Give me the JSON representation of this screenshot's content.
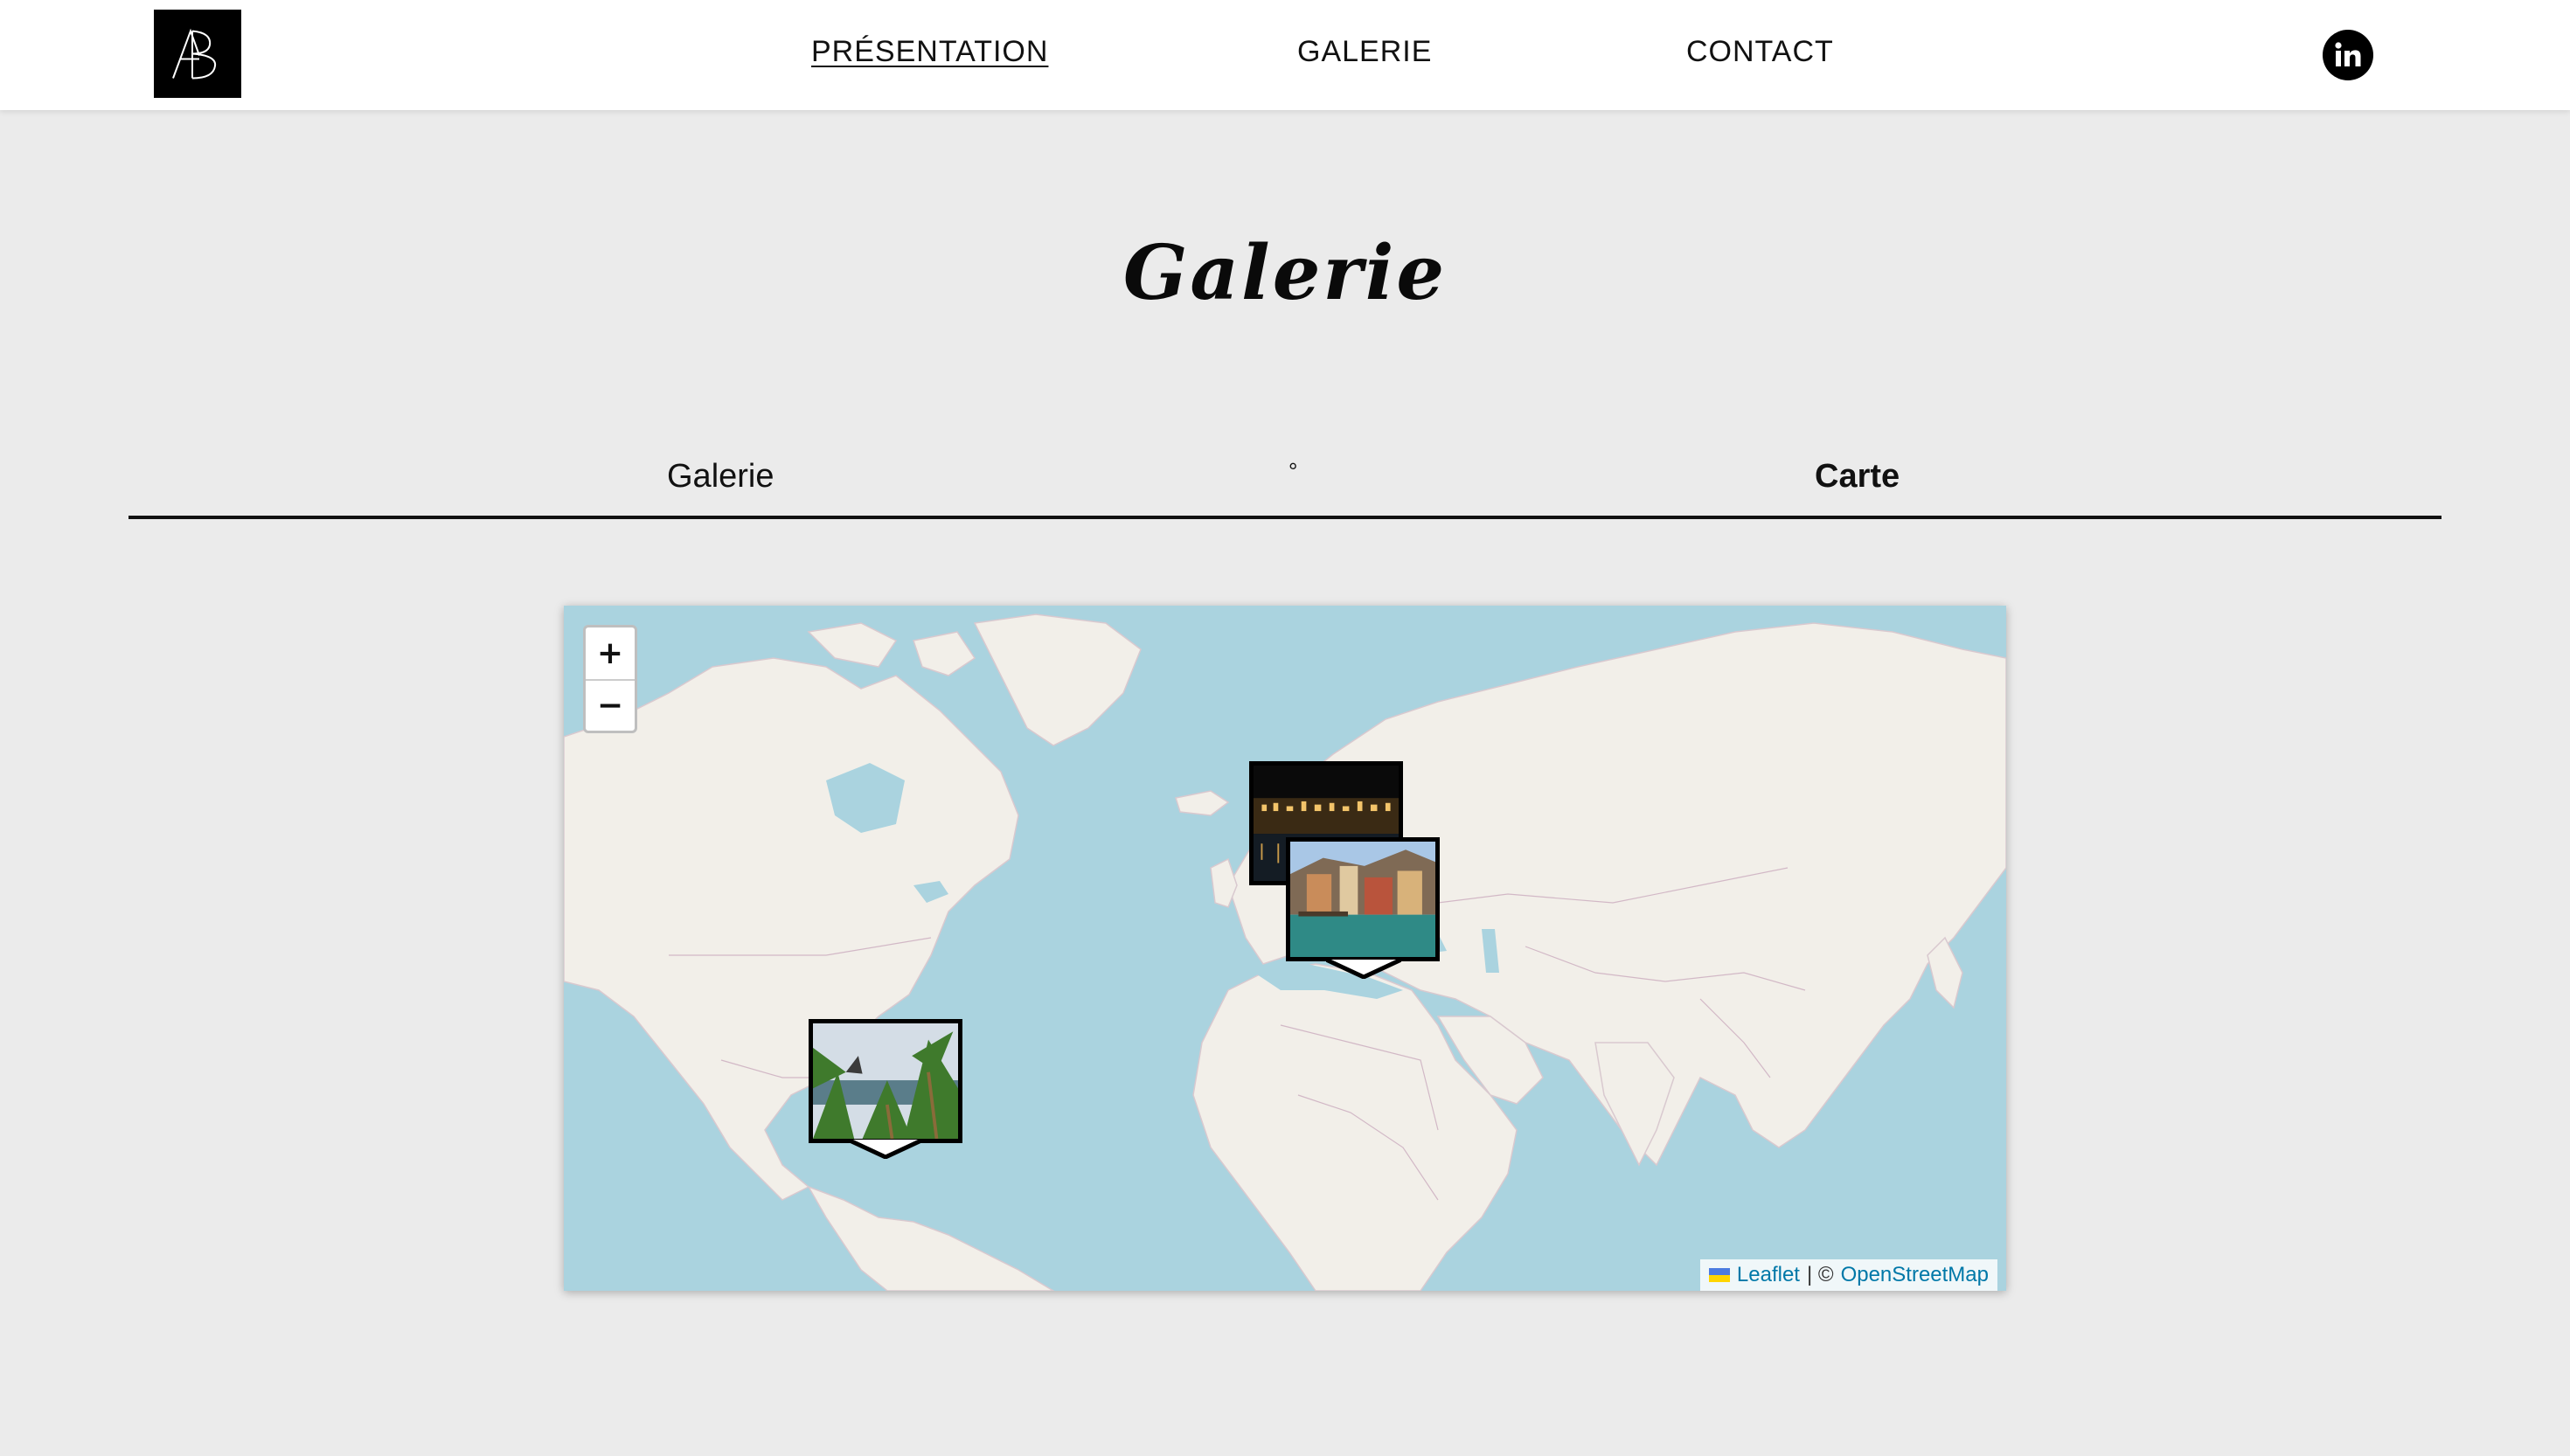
{
  "header": {
    "logo_text": "AB",
    "nav": [
      {
        "label": "PRÉSENTATION",
        "active": true
      },
      {
        "label": "GALERIE",
        "active": false
      },
      {
        "label": "CONTACT",
        "active": false
      }
    ],
    "social_icon": "linkedin-icon",
    "social_label": "in"
  },
  "page": {
    "title": "Galerie"
  },
  "tabs": {
    "galerie_label": "Galerie",
    "separator": "°",
    "carte_label": "Carte",
    "active": "Carte"
  },
  "map": {
    "zoom_in": "+",
    "zoom_out": "−",
    "markers": [
      {
        "name": "marker-europe-night-city",
        "icon": "photo-thumbnail"
      },
      {
        "name": "marker-europe-harbor",
        "icon": "photo-thumbnail"
      },
      {
        "name": "marker-central-america-palms",
        "icon": "photo-thumbnail"
      }
    ],
    "attribution": {
      "leaflet": "Leaflet",
      "separator": "| ©",
      "osm": "OpenStreetMap"
    },
    "colors": {
      "water": "#aad3df",
      "land": "#f2efe9",
      "link": "#0078a8"
    }
  }
}
